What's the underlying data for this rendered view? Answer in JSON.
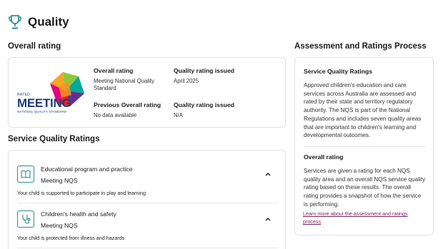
{
  "page": {
    "title": "Quality",
    "icon": "trophy-icon"
  },
  "overall": {
    "section_title": "Overall rating",
    "logo": {
      "rated": "RATED",
      "meeting": "MEETING",
      "sub": "NATIONAL QUALITY STANDARD"
    },
    "fields": {
      "overall_label": "Overall rating",
      "overall_value": "Meeting National Quality Standard",
      "issued_label": "Quality rating issued",
      "issued_value": "April 2025",
      "previous_label": "Previous Overall rating",
      "previous_value": "No data available",
      "previous_issued_label": "Quality rating issued",
      "previous_issued_value": "N/A"
    }
  },
  "service_quality": {
    "section_title": "Service Quality Ratings",
    "items": [
      {
        "title": "Educational program and practice",
        "status": "Meeting NQS",
        "description": "Your child is supported to participate in play and learning",
        "icon": "book-icon"
      },
      {
        "title": "Children's health and safety",
        "status": "Meeting NQS",
        "description": "Your child is protected from illness and hazards",
        "icon": "stethoscope-icon"
      }
    ]
  },
  "process": {
    "section_title": "Assessment and Ratings Process",
    "heading1": "Service Quality Ratings",
    "text1": "Approved children's education and care services across Australia are assessed and rated by their state and territory regulatory authority. The NQS is part of the National Regulations and includes seven quality areas that are important to children's learning and developmental outcomes.",
    "heading2": "Overall rating",
    "text2": "Services are given a rating for each NQS quality area and an overall NQS service quality rating based on these results. The overall rating provides a snapshot of how the service is performing.",
    "link": "Learn more about the assessment and ratings process"
  },
  "colors": {
    "accent": "#2a8f8b",
    "link": "#7a1f5c",
    "logo_navy": "#1f3b73"
  }
}
